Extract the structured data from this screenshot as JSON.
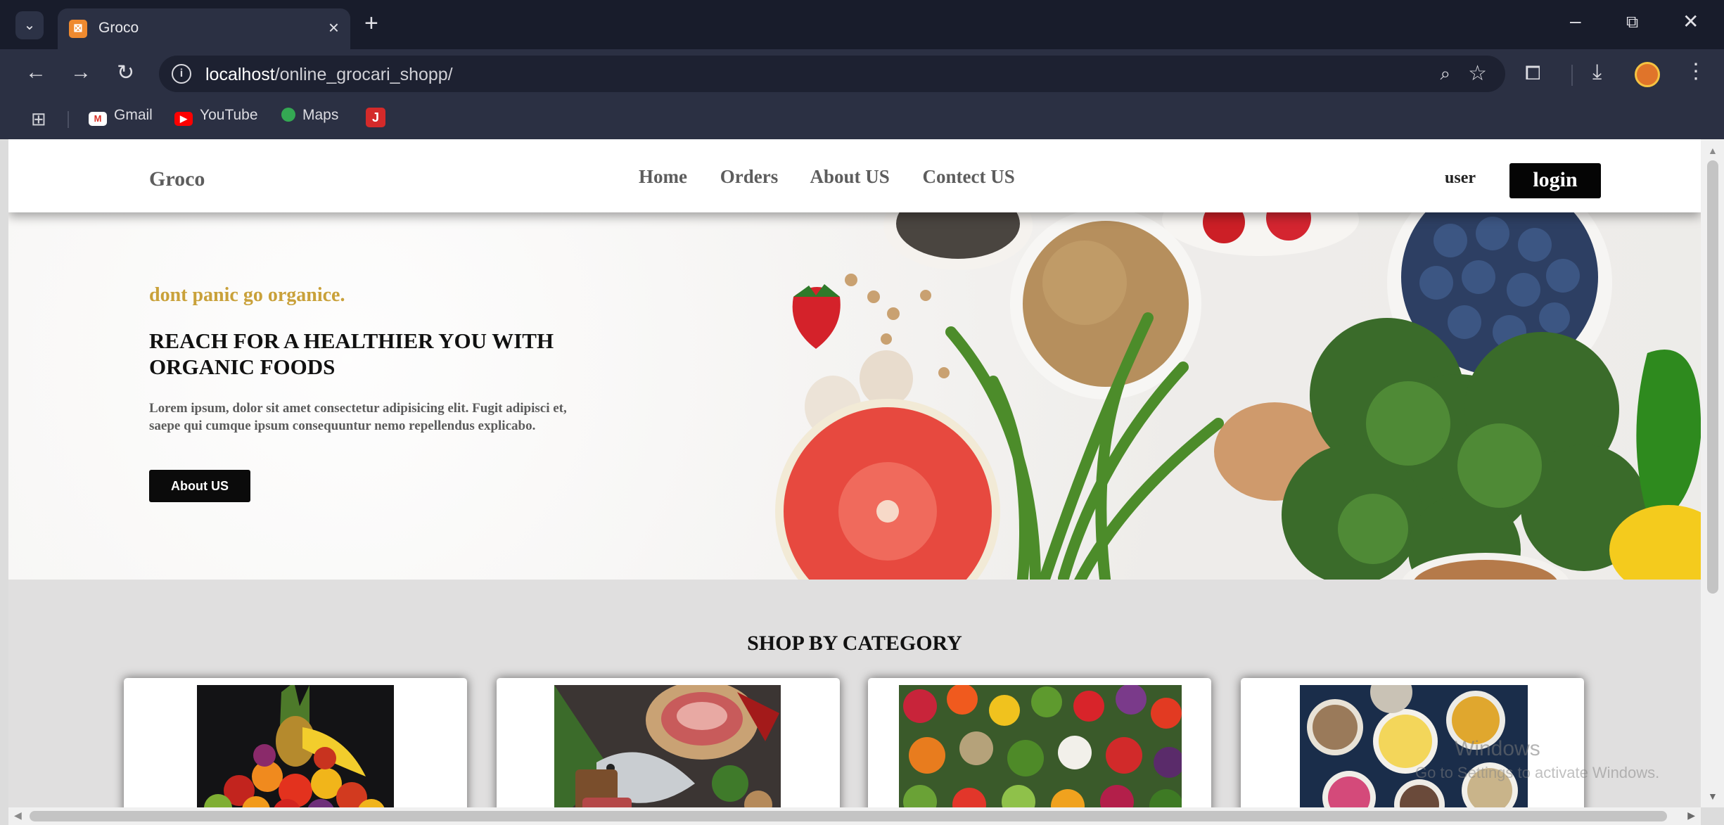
{
  "browser": {
    "tab_title": "Groco",
    "url_host": "localhost",
    "url_path": "/online_grocari_shopp/",
    "bookmarks": [
      {
        "label": "Gmail"
      },
      {
        "label": "YouTube"
      },
      {
        "label": "Maps"
      },
      {
        "label": ""
      }
    ]
  },
  "site": {
    "brand": "Groco",
    "nav": [
      "Home",
      "Orders",
      "About US",
      "Contect US"
    ],
    "user_label": "user",
    "login_label": "login"
  },
  "hero": {
    "tagline": "dont panic go organice.",
    "title": "REACH FOR A HEALTHIER YOU WITH ORGANIC FOODS",
    "body": "Lorem ipsum, dolor sit amet consectetur adipisicing elit. Fugit adipisci et, saepe qui cumque ipsum consequuntur nemo repellendus explicabo.",
    "button_label": "About US"
  },
  "category": {
    "title": "SHOP BY CATEGORY",
    "cards": [
      {
        "name": "fruits"
      },
      {
        "name": "meat-and-fish"
      },
      {
        "name": "vegetables"
      },
      {
        "name": "snacks"
      }
    ]
  },
  "os": {
    "watermark_line1": "Windows",
    "watermark_line2": "Go to Settings to activate Windows."
  },
  "colors": {
    "tagline": "#c9a13a",
    "button_bg": "#050505",
    "chrome_bg": "#1f2436"
  }
}
